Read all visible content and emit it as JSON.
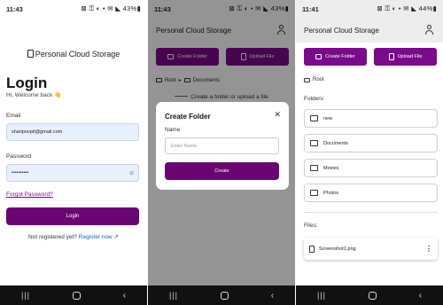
{
  "screen1": {
    "status": {
      "time": "11:43",
      "icons": "⊠ ⚿ ◐ • ✉ ◣ 43%▮"
    },
    "brand": "Personal Cloud Storage",
    "title": "Login",
    "welcome": "Hi, Welcome back 👋",
    "email_label": "Email",
    "email_value": "sharipovpit@gmail.com",
    "password_label": "Password",
    "password_value": "••••••••••",
    "forgot": "Forgot Password?",
    "login_button": "Login",
    "register_text": "Not registered yet?",
    "register_link": "Register now ↗"
  },
  "screen2": {
    "status": {
      "time": "11:43",
      "icons": "⊠ ⚿ ◐ • ✉ ◣ 43%▮"
    },
    "app_title": "Personal Cloud Storage",
    "create_folder": "Create Folder",
    "upload_file": "Upload File",
    "crumb_root": "Root",
    "crumb_sep": "▸",
    "crumb_documents": "Documents",
    "hint": "Create a folder or upload a file",
    "modal": {
      "title": "Create Folder",
      "close": "✕",
      "name_label": "Name",
      "name_placeholder": "Enter Name",
      "create_button": "Create"
    }
  },
  "screen3": {
    "status": {
      "time": "11:41",
      "icons": "⊠ ⚿ ◐ • ✉ ◣ 44%▮"
    },
    "app_title": "Personal Cloud Storage",
    "create_folder": "Create Folder",
    "upload_file": "Upload File",
    "crumb_root": "Root",
    "folders_label": "Folders:",
    "folders": [
      "new",
      "Documents",
      "Movies",
      "Photos"
    ],
    "files_label": "Files:",
    "files": [
      "Screenshot1.png"
    ],
    "more": "⋮"
  },
  "navbar": {
    "recent": "|||",
    "back": "‹"
  },
  "colors": {
    "accent": "#6a0572",
    "input_bg": "#e8f0fe",
    "nav_bg": "#111111"
  }
}
